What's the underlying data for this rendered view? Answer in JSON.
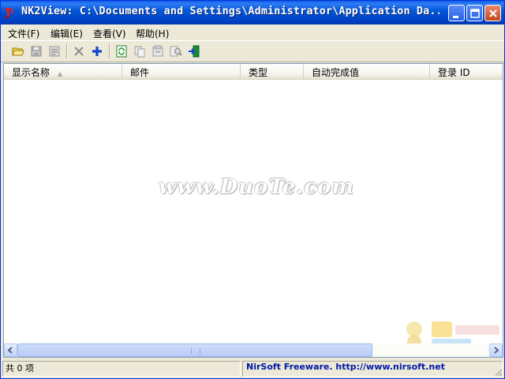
{
  "window": {
    "title": "NK2View:  C:\\Documents and Settings\\Administrator\\Application Da..."
  },
  "menu": [
    {
      "label": "文件(F)"
    },
    {
      "label": "编辑(E)"
    },
    {
      "label": "查看(V)"
    },
    {
      "label": "帮助(H)"
    }
  ],
  "toolbar": [
    {
      "icon": "open-folder-icon"
    },
    {
      "icon": "save-icon"
    },
    {
      "icon": "properties-icon"
    },
    {
      "icon": "delete-icon"
    },
    {
      "icon": "add-icon"
    },
    {
      "icon": "refresh-icon"
    },
    {
      "icon": "copy-icon"
    },
    {
      "icon": "html-report-icon"
    },
    {
      "icon": "find-icon"
    },
    {
      "icon": "exit-icon"
    }
  ],
  "columns": [
    {
      "label": "显示名称",
      "sorted": true
    },
    {
      "label": "邮件"
    },
    {
      "label": "类型"
    },
    {
      "label": "自动完成值"
    },
    {
      "label": "登录 ID"
    }
  ],
  "watermark": {
    "text": "www.DuoTe.com"
  },
  "status": {
    "count": "共 0 项",
    "link": "NirSoft Freeware.  http://www.nirsoft.net"
  },
  "colors": {
    "titlebar": "#0458d8",
    "link": "#0018a8",
    "add": "#1446c8",
    "delete": "#808080"
  }
}
